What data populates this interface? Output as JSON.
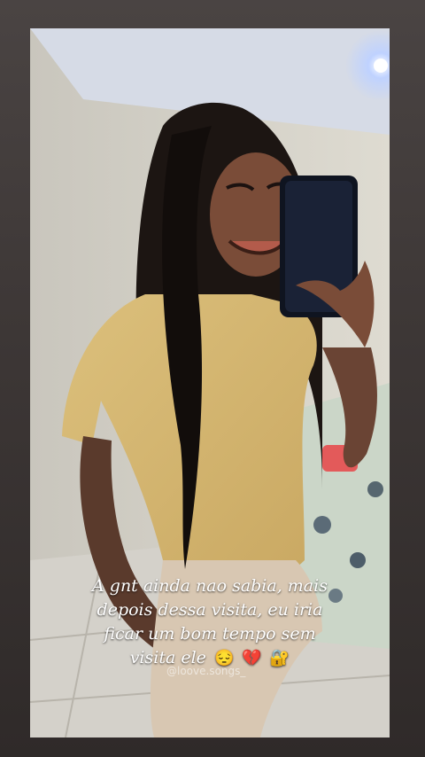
{
  "story": {
    "caption_lines": [
      "A gnt ainda nao sabia, mais",
      "depois dessa visita, eu iria",
      "ficar um bom tempo sem",
      "visita ele"
    ],
    "emojis": [
      "😔",
      "💔",
      "🔐"
    ],
    "watermark": "@loove.songs_"
  },
  "colors": {
    "frame": "#3a3534",
    "shirt": "#d6b86e",
    "hair": "#1c1512",
    "phone": "#0f1420",
    "light": "#bfd2ff"
  },
  "scene": {
    "subject": "woman-taking-mirror-selfie",
    "icons": [
      "phone-icon"
    ]
  }
}
